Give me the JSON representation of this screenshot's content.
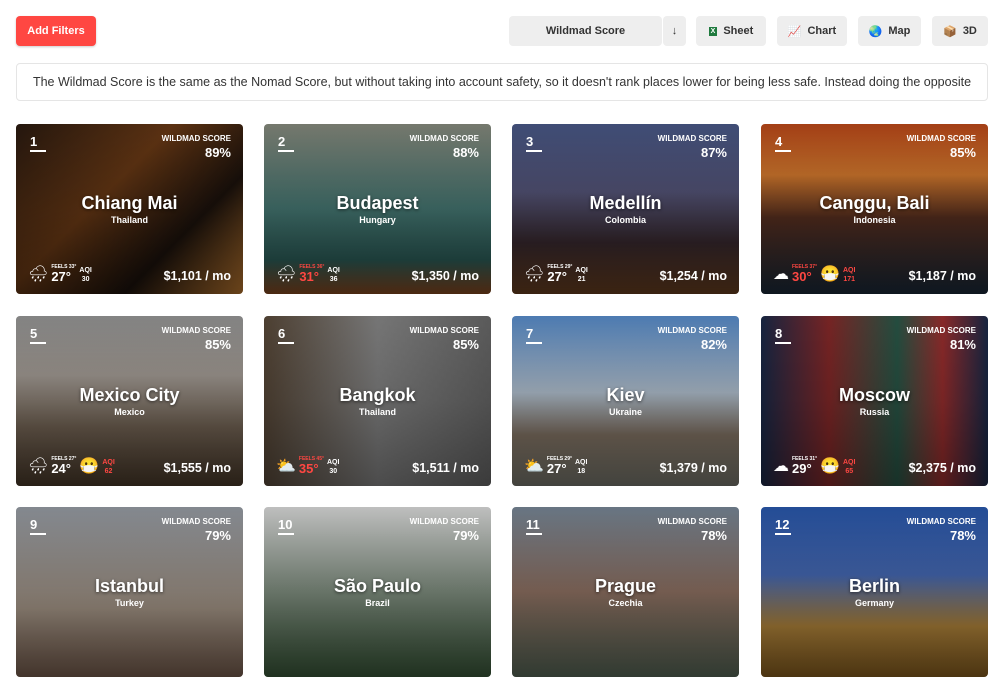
{
  "toolbar": {
    "add_filters": "Add Filters",
    "sort": "Wildmad Score",
    "sort_dir": "↓",
    "sheet": "Sheet",
    "chart": "Chart",
    "map": "Map",
    "three_d": "3D"
  },
  "description": "The Wildmad Score is the same as the Nomad Score, but without taking into account safety, so it doesn't rank places lower for being less safe. Instead doing the opposite",
  "score_label": "WILDMAD SCORE",
  "cards": [
    {
      "rank": "1",
      "city": "Chiang Mai",
      "country": "Thailand",
      "score": "89%",
      "feels": "FEELS 33°",
      "temp": "27°",
      "aqi": "30",
      "price": "$1,101 / mo",
      "weather": "🌧",
      "hot": false,
      "bad_aqi": false,
      "bg": "linear-gradient(135deg,#2a1a10,#6b3a15 40%,#1c120c 70%,#c07a30)"
    },
    {
      "rank": "2",
      "city": "Budapest",
      "country": "Hungary",
      "score": "88%",
      "feels": "FEELS 36°",
      "temp": "31°",
      "aqi": "36",
      "price": "$1,350 / mo",
      "weather": "🌧",
      "hot": true,
      "bad_aqi": false,
      "bg": "linear-gradient(180deg,#8a8d80,#4a7f7a 50%,#2d5f5a 80%,#8a4a20)"
    },
    {
      "rank": "3",
      "city": "Medellín",
      "country": "Colombia",
      "score": "87%",
      "feels": "FEELS 29°",
      "temp": "27°",
      "aqi": "21",
      "price": "$1,254 / mo",
      "weather": "🌧",
      "hot": false,
      "bad_aqi": false,
      "bg": "linear-gradient(180deg,#4a5a8a,#5a5a80 40%,#3a2a30 70%,#6a4020)"
    },
    {
      "rank": "4",
      "city": "Canggu, Bali",
      "country": "Indonesia",
      "score": "85%",
      "feels": "FEELS 37°",
      "temp": "30°",
      "aqi": "171",
      "price": "$1,187 / mo",
      "weather": "☁",
      "hot": true,
      "bad_aqi": true,
      "bg": "linear-gradient(180deg,#c04a1a,#e08030 30%,#5a3020 55%,#1a2a3a)"
    },
    {
      "rank": "5",
      "city": "Mexico City",
      "country": "Mexico",
      "score": "85%",
      "feels": "FEELS 27°",
      "temp": "24°",
      "aqi": "62",
      "price": "$1,555 / mo",
      "weather": "🌧",
      "hot": false,
      "bad_aqi": true,
      "bg": "linear-gradient(180deg,#9a9a9a,#b0a8a0 35%,#7a6a5a 65%,#4a3a2a)"
    },
    {
      "rank": "6",
      "city": "Bangkok",
      "country": "Thailand",
      "score": "85%",
      "feels": "FEELS 45°",
      "temp": "35°",
      "aqi": "30",
      "price": "$1,511 / mo",
      "weather": "⛅",
      "hot": true,
      "bad_aqi": false,
      "bg": "linear-gradient(90deg,#5a4a3a,#8a8a8a 50%,#6a6a6a)"
    },
    {
      "rank": "7",
      "city": "Kiev",
      "country": "Ukraine",
      "score": "82%",
      "feels": "FEELS 29°",
      "temp": "27°",
      "aqi": "18",
      "price": "$1,379 / mo",
      "weather": "⛅",
      "hot": false,
      "bad_aqi": false,
      "bg": "linear-gradient(180deg,#5a90d0,#c0d0e0 45%,#8a7a6a 70%,#7a7a70)"
    },
    {
      "rank": "8",
      "city": "Moscow",
      "country": "Russia",
      "score": "81%",
      "feels": "FEELS 31°",
      "temp": "29°",
      "aqi": "65",
      "price": "$2,375 / mo",
      "weather": "☁",
      "hot": false,
      "bad_aqi": true,
      "bg": "linear-gradient(90deg,#1a2a4a,#8a2a2a 30%,#2a5a4a 60%,#a03030 80%,#1a2a4a)"
    },
    {
      "rank": "9",
      "city": "Istanbul",
      "country": "Turkey",
      "score": "79%",
      "price": "",
      "bg": "linear-gradient(180deg,#9aa0a8,#b0a090 60%,#7a6050)"
    },
    {
      "rank": "10",
      "city": "São Paulo",
      "country": "Brazil",
      "score": "79%",
      "price": "",
      "bg": "linear-gradient(180deg,#e0e0e0,#8a9a8a 50%,#3a5a3a)"
    },
    {
      "rank": "11",
      "city": "Prague",
      "country": "Czechia",
      "score": "78%",
      "price": "",
      "bg": "linear-gradient(180deg,#7a8a9a,#9a7a6a 50%,#5a6a5a)"
    },
    {
      "rank": "12",
      "city": "Berlin",
      "country": "Germany",
      "score": "78%",
      "price": "",
      "bg": "linear-gradient(180deg,#2a5ab0,#4a70c0 40%,#c09040 70%,#8a6020)"
    }
  ]
}
